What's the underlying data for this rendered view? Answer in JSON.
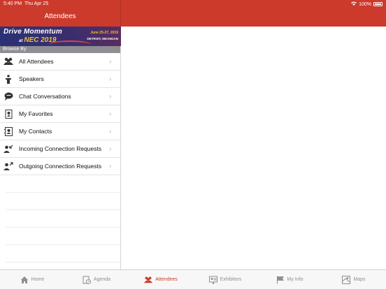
{
  "status_bar": {
    "time": "5:40 PM",
    "date": "Thu Apr 25",
    "battery": "100%"
  },
  "header": {
    "title": "Attendees"
  },
  "banner": {
    "line1": "Drive Momentum",
    "line2_prefix": "at",
    "line2": "NEC 2019",
    "dates": "June 25-27, 2019",
    "location": "DETROIT, MICHIGAN"
  },
  "sidebar": {
    "section_label": "Browse By",
    "items": [
      {
        "label": "All Attendees",
        "icon": "people-icon"
      },
      {
        "label": "Speakers",
        "icon": "podium-icon"
      },
      {
        "label": "Chat Conversations",
        "icon": "chat-bubble-icon"
      },
      {
        "label": "My Favorites",
        "icon": "bookmark-icon"
      },
      {
        "label": "My Contacts",
        "icon": "contacts-book-icon"
      },
      {
        "label": "Incoming Connection Requests",
        "icon": "incoming-request-icon"
      },
      {
        "label": "Outgoing Connection Requests",
        "icon": "outgoing-request-icon"
      }
    ]
  },
  "tabbar": {
    "tabs": [
      {
        "label": "Home",
        "icon": "home-icon",
        "active": false
      },
      {
        "label": "Agenda",
        "icon": "agenda-icon",
        "active": false
      },
      {
        "label": "Attendees",
        "icon": "attendees-icon",
        "active": true
      },
      {
        "label": "Exhibitors",
        "icon": "exhibitors-icon",
        "active": false
      },
      {
        "label": "My Info",
        "icon": "flag-icon",
        "active": false
      },
      {
        "label": "Maps",
        "icon": "map-icon",
        "active": false
      }
    ]
  },
  "colors": {
    "accent": "#cc3a2c",
    "inactive": "#8e8e93"
  }
}
